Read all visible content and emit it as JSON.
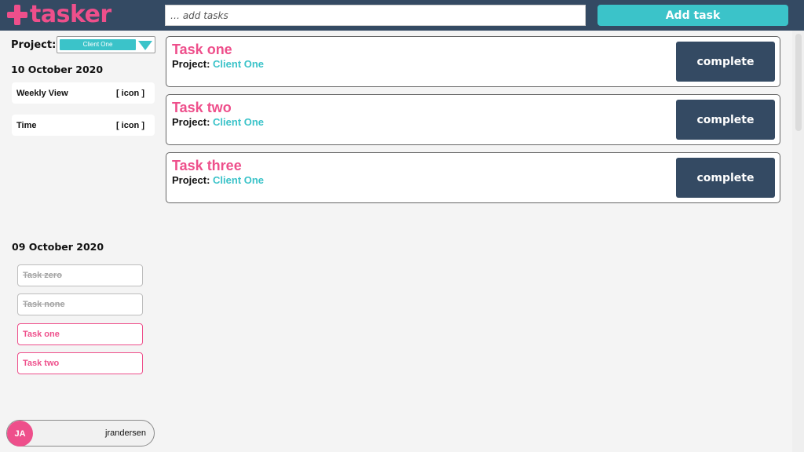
{
  "header": {
    "logo_text": "tasker",
    "add_placeholder": "… add tasks",
    "add_button": "Add task",
    "colors": {
      "bar": "#344a63",
      "brand_pink": "#ee4f8b",
      "accent_teal": "#3bc3c9"
    }
  },
  "sidebar": {
    "project_label": "Project:",
    "project_selected": "Client One",
    "today": {
      "date": "10 October 2020",
      "cards": [
        {
          "label": "Weekly View",
          "icon_text": "[ icon ]"
        },
        {
          "label": "Time",
          "icon_text": "[ icon ]"
        }
      ]
    },
    "previous": {
      "date": "09 October 2020",
      "tasks": [
        {
          "label": "Task zero",
          "done": true
        },
        {
          "label": "Task none",
          "done": true
        },
        {
          "label": "Task one",
          "done": false
        },
        {
          "label": "Task two",
          "done": false
        }
      ]
    },
    "user": {
      "initials": "JA",
      "username": "jrandersen"
    }
  },
  "tasks": [
    {
      "title": "Task one",
      "project_label": "Project:",
      "project": "Client One",
      "action": "complete"
    },
    {
      "title": "Task two",
      "project_label": "Project:",
      "project": "Client One",
      "action": "complete"
    },
    {
      "title": "Task three",
      "project_label": "Project:",
      "project": "Client One",
      "action": "complete"
    }
  ]
}
